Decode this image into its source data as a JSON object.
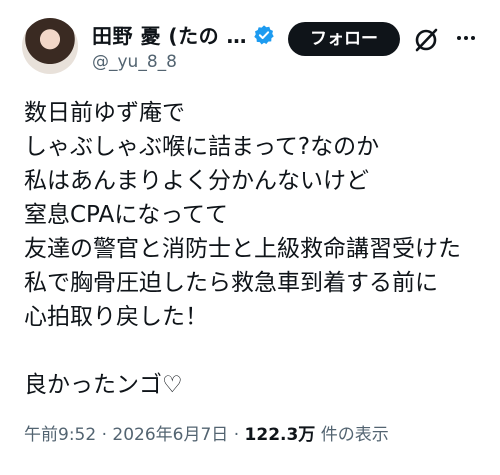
{
  "user": {
    "display_name": "田野 憂 (たの …",
    "handle": "@_yu_8_8",
    "verified": true
  },
  "actions": {
    "follow_label": "フォロー",
    "grok_icon": "grok-icon",
    "more_icon": "more-icon"
  },
  "post": {
    "lines": [
      "数日前ゆず庵で",
      "しゃぶしゃぶ喉に詰まって?なのか",
      "私はあんまりよく分かんないけど",
      "窒息CPAになってて",
      "友達の警官と消防士と上級救命講習受けた",
      "私で胸骨圧迫したら救急車到着する前に",
      "心拍取り戻した！",
      "",
      "良かったンゴ♡"
    ]
  },
  "meta": {
    "time": "午前9:52",
    "sep1": " · ",
    "date": "2026年6月7日",
    "sep2": " · ",
    "views_count": "122.3万",
    "views_label": " 件の表示"
  },
  "colors": {
    "text": "#0f1419",
    "secondary": "#536471",
    "verified": "#1d9bf0",
    "button_bg": "#0f1419"
  }
}
